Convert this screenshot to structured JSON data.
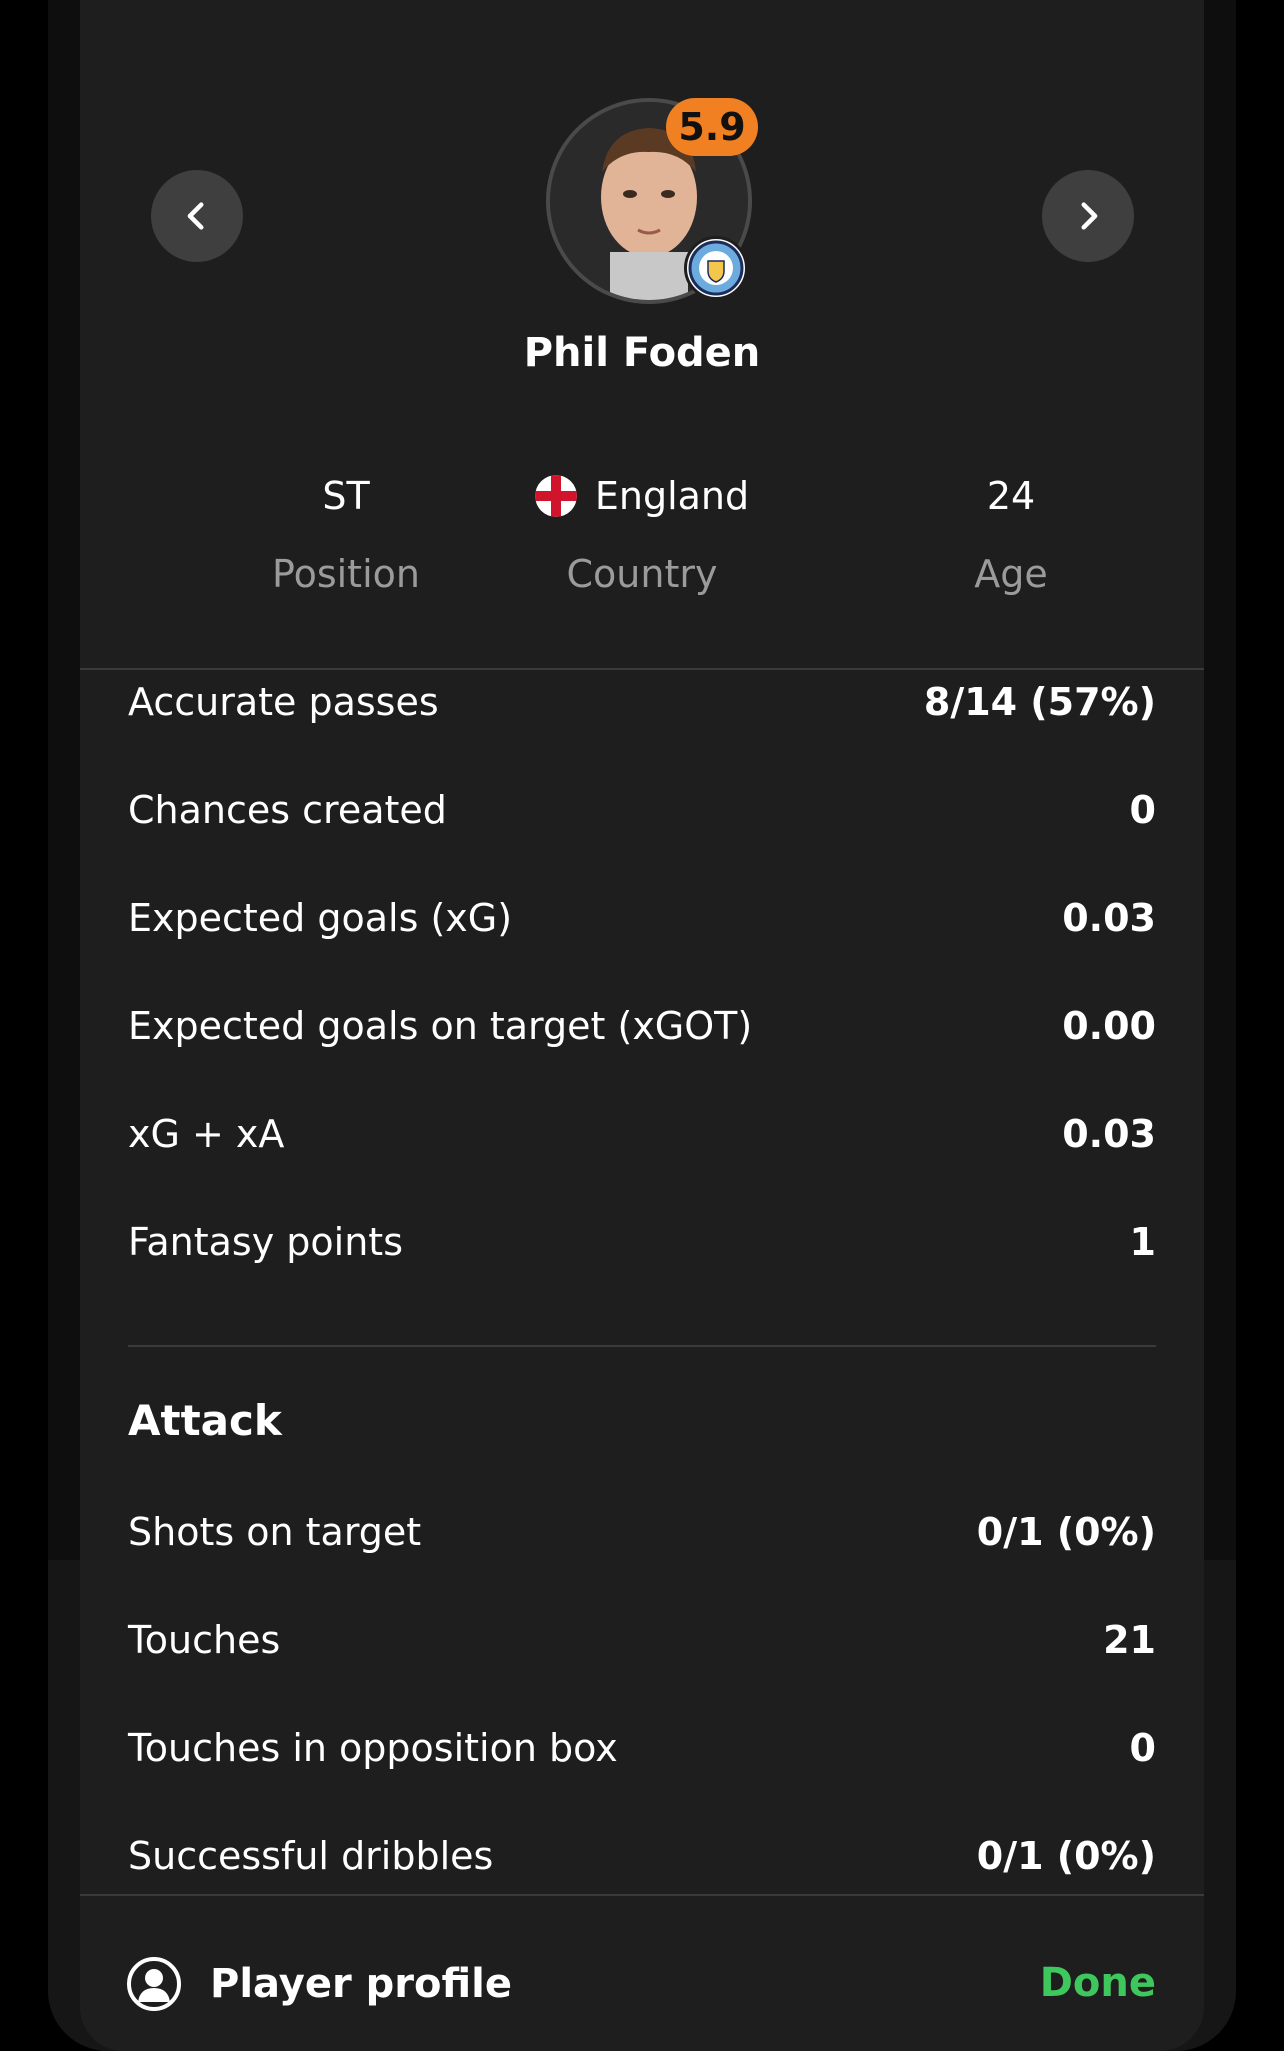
{
  "player": {
    "name": "Phil Foden",
    "rating": "5.9",
    "rating_color": "#f08022",
    "club_badge": "manchester-city-crest"
  },
  "info": {
    "position_value": "ST",
    "position_label": "Position",
    "country_value": "England",
    "country_flag": "england-flag-icon",
    "country_label": "Country",
    "age_value": "24",
    "age_label": "Age"
  },
  "stats": [
    {
      "label": "Accurate passes",
      "value": "8/14 (57%)"
    },
    {
      "label": "Chances created",
      "value": "0"
    },
    {
      "label": "Expected goals (xG)",
      "value": "0.03"
    },
    {
      "label": "Expected goals on target (xGOT)",
      "value": "0.00"
    },
    {
      "label": "xG + xA",
      "value": "0.03"
    },
    {
      "label": "Fantasy points",
      "value": "1"
    }
  ],
  "attack": {
    "title": "Attack",
    "rows": [
      {
        "label": "Shots on target",
        "value": "0/1 (0%)"
      },
      {
        "label": "Touches",
        "value": "21"
      },
      {
        "label": "Touches in opposition box",
        "value": "0"
      },
      {
        "label": "Successful dribbles",
        "value": "0/1 (0%)"
      }
    ]
  },
  "footer": {
    "profile_label": "Player profile",
    "done_label": "Done",
    "done_color": "#3ec75c"
  }
}
